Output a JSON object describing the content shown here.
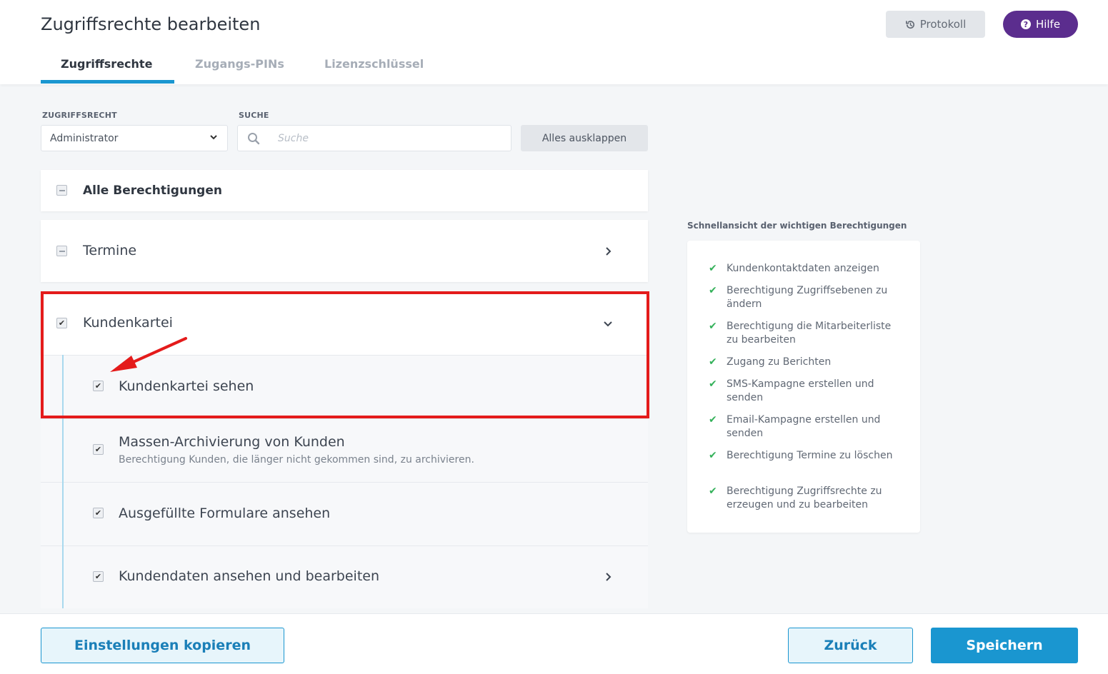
{
  "header": {
    "title": "Zugriffsrechte bearbeiten",
    "protokoll_label": "Protokoll",
    "hilfe_label": "Hilfe"
  },
  "tabs": [
    {
      "label": "Zugriffsrechte",
      "active": true
    },
    {
      "label": "Zugangs-PINs",
      "active": false
    },
    {
      "label": "Lizenzschlüssel",
      "active": false
    }
  ],
  "filters": {
    "role_label": "ZUGRIFFSRECHT",
    "role_value": "Administrator",
    "search_label": "SUCHE",
    "search_placeholder": "Suche",
    "expand_all_label": "Alles ausklappen"
  },
  "permissions": {
    "all_label": "Alle Berechtigungen",
    "termine_label": "Termine",
    "kundenkartei_label": "Kundenkartei",
    "sub_items": [
      {
        "title": "Kundenkartei sehen",
        "desc": "",
        "checked": true
      },
      {
        "title": "Massen-Archivierung von Kunden",
        "desc": "Berechtigung Kunden, die länger nicht gekommen sind, zu archivieren.",
        "checked": true
      },
      {
        "title": "Ausgefüllte Formulare ansehen",
        "desc": "",
        "checked": true
      },
      {
        "title": "Kundendaten ansehen und bearbeiten",
        "desc": "",
        "checked": true
      }
    ]
  },
  "quick_view": {
    "heading": "Schnellansicht der wichtigen Berechtigungen",
    "items": [
      "Kundenkontaktdaten anzeigen",
      "Berechtigung Zugriffsebenen zu ändern",
      "Berechtigung die Mitarbeiterliste zu bearbeiten",
      "Zugang zu Berichten",
      "SMS-Kampagne erstellen und senden",
      "Email-Kampagne erstellen und senden",
      "Berechtigung Termine zu löschen",
      "Berechtigung Zugriffsrechte zu erzeugen und zu bearbeiten"
    ]
  },
  "footer": {
    "copy_label": "Einstellungen kopieren",
    "back_label": "Zurück",
    "save_label": "Speichern"
  },
  "colors": {
    "accent": "#1a96d0",
    "help_button": "#5b2d8e",
    "highlight": "#e41b1b",
    "check": "#34b15a"
  },
  "icons": {
    "protokoll": "history-icon",
    "hilfe": "question-circle-icon",
    "search": "search-icon",
    "select": "chevron-down-icon",
    "quick_view_item": "check-icon"
  }
}
